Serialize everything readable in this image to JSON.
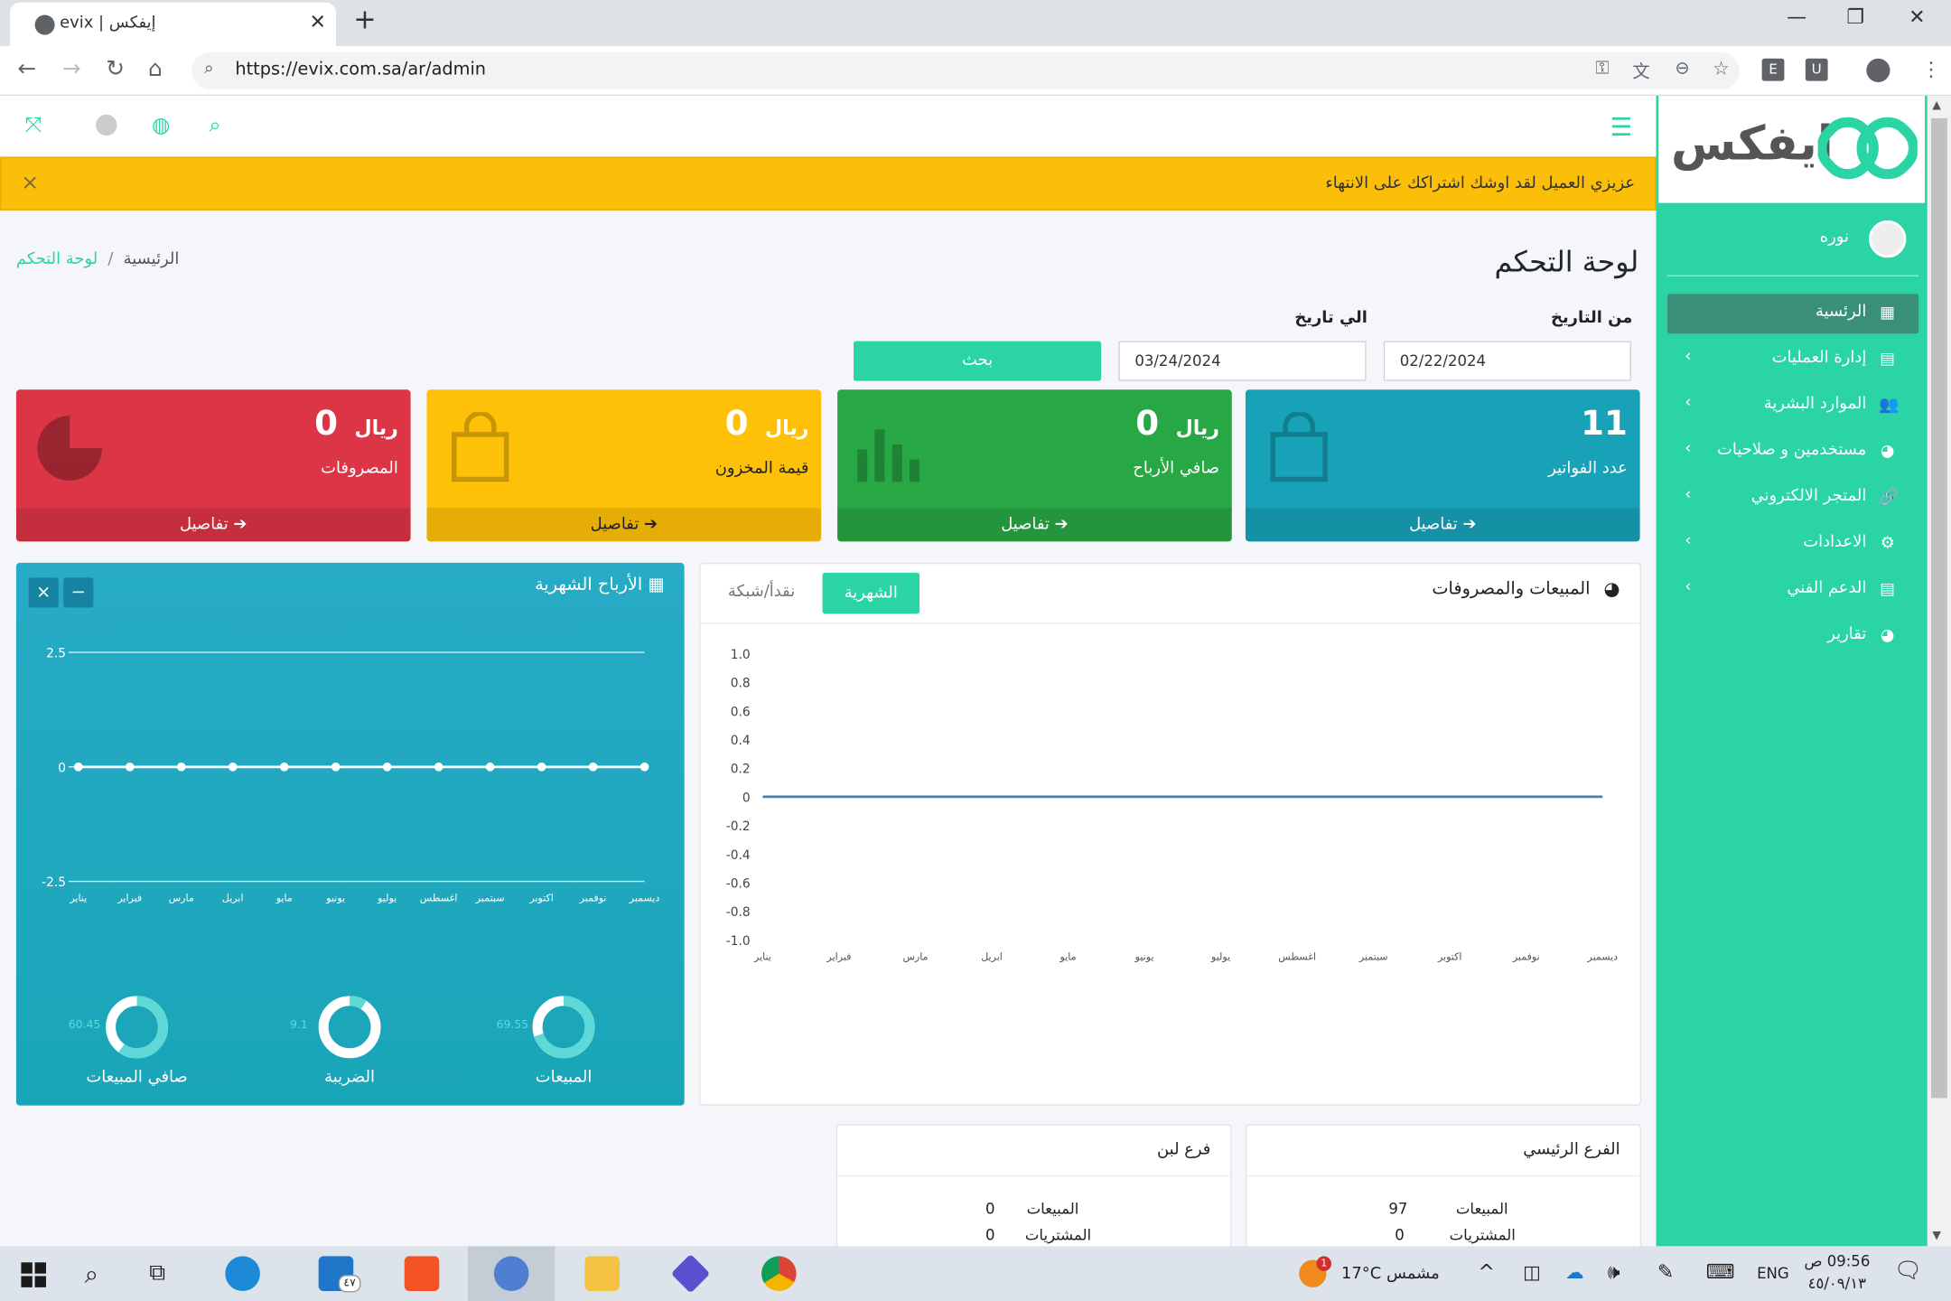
{
  "browser": {
    "tab_title": "evix | إيفكس",
    "url": "https://evix.com.sa/ar/admin"
  },
  "sidebar": {
    "logo_text": "ايفكس",
    "user_name": "نوره",
    "items": [
      {
        "label": "الرئسية",
        "icon": "grid-icon",
        "active": true
      },
      {
        "label": "إدارة العمليات",
        "icon": "book-icon"
      },
      {
        "label": "الموارد البشرية",
        "icon": "users-icon"
      },
      {
        "label": "مستخدمين و صلاحيات",
        "icon": "pie-icon"
      },
      {
        "label": "المتجر الالكتروني",
        "icon": "link-icon"
      },
      {
        "label": "الاعدادات",
        "icon": "gears-icon"
      },
      {
        "label": "الدعم الفني",
        "icon": "book-icon"
      },
      {
        "label": "تقارير",
        "icon": "pie-icon"
      }
    ]
  },
  "alert": {
    "text": "عزيزي العميل لقد اوشك اشتراكك على الانتهاء",
    "close": "×"
  },
  "page": {
    "title": "لوحة التحكم",
    "breadcrumb_home": "الرئيسية",
    "breadcrumb_sep": "/",
    "breadcrumb_current": "لوحة التحكم"
  },
  "filters": {
    "from_label": "من التاريخ",
    "to_label": "الي تاريخ",
    "from_value": "02/22/2024",
    "to_value": "03/24/2024",
    "search_label": "بحث"
  },
  "cards": [
    {
      "value": "11",
      "currency": "",
      "caption": "عدد الفواتير",
      "details": "تفاصيل",
      "color": "#17a2b8"
    },
    {
      "value": "0",
      "currency": "ريال",
      "caption": "صافي الأرباح",
      "details": "تفاصيل",
      "color": "#28a745"
    },
    {
      "value": "0",
      "currency": "ريال",
      "caption": "قيمة المخزون",
      "details": "تفاصيل",
      "color": "#ffc107"
    },
    {
      "value": "0",
      "currency": "ريال",
      "caption": "المصروفات",
      "details": "تفاصيل",
      "color": "#dc3545"
    }
  ],
  "sales_panel": {
    "title": "المبيعات والمصروفات",
    "tab_monthly": "الشهرية",
    "tab_cash": "نقدأ/شبكة"
  },
  "profit_panel": {
    "title": "الأرباح الشهرية",
    "close": "×",
    "minimize": "−",
    "donuts": [
      {
        "label": "المبيعات",
        "value": "69.55",
        "fraction": 0.7
      },
      {
        "label": "الضريبة",
        "value": "9.1",
        "fraction": 0.09
      },
      {
        "label": "صافي المبيعات",
        "value": "60.45",
        "fraction": 0.6
      }
    ]
  },
  "chart_data": [
    {
      "type": "line",
      "title": "المبيعات والمصروفات",
      "categories": [
        "يناير",
        "فبراير",
        "مارس",
        "ابريل",
        "مايو",
        "يونيو",
        "يوليو",
        "اغسطس",
        "سبتمبر",
        "اكتوبر",
        "نوفمبر",
        "ديسمبر"
      ],
      "series": [
        {
          "values": [
            0,
            0,
            0,
            0,
            0,
            0,
            0,
            0,
            0,
            0,
            0,
            0
          ]
        }
      ],
      "yticks": [
        "1.0",
        "0.8",
        "0.6",
        "0.4",
        "0.2",
        "0",
        "-0.2",
        "-0.4",
        "-0.6",
        "-0.8",
        "-1.0"
      ],
      "ylim": [
        -1,
        1
      ]
    },
    {
      "type": "line",
      "title": "الأرباح الشهرية",
      "categories": [
        "يناير",
        "فبراير",
        "مارس",
        "ابريل",
        "مايو",
        "يونيو",
        "يوليو",
        "اغسطس",
        "سبتمبر",
        "اكتوبر",
        "نوفمبر",
        "ديسمبر"
      ],
      "series": [
        {
          "values": [
            0,
            0,
            0,
            0,
            0,
            0,
            0,
            0,
            0,
            0,
            0,
            0
          ]
        }
      ],
      "yticks": [
        "2.5",
        "0",
        "-2.5"
      ],
      "ylim": [
        -2.5,
        2.5
      ]
    }
  ],
  "branches": [
    {
      "name": "الفرع الرئيسي",
      "sales_label": "المبيعات",
      "sales": "97",
      "purchases_label": "المشتريات",
      "purchases": "0"
    },
    {
      "name": "فرع لبن",
      "sales_label": "المبيعات",
      "sales": "0",
      "purchases_label": "المشتريات",
      "purchases": "0"
    }
  ],
  "taskbar": {
    "weather": "17°C  مشمس",
    "lang": "ENG",
    "time": "09:56 ص",
    "date": "٤٥/٠٩/١٣",
    "mail_badge": "٤٧",
    "notif_badge": "1"
  }
}
